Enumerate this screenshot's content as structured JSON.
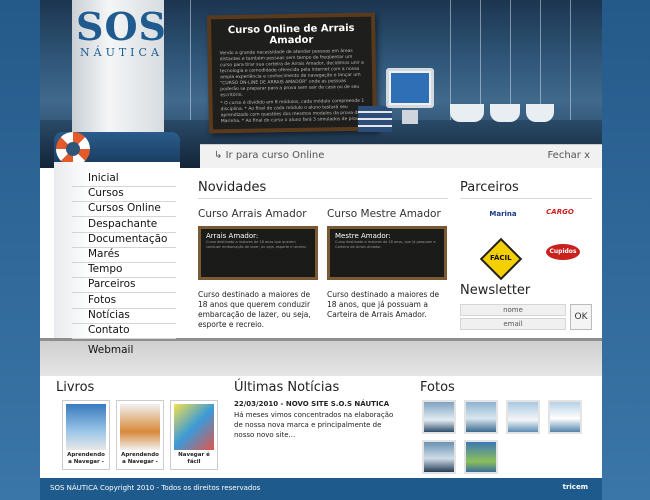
{
  "logo": {
    "sos": "SOS",
    "nautica": "NÁUTICA"
  },
  "banner": {
    "board_title": "Curso Online de Arrais Amador",
    "board_text": "Vendo a grande necessidade de atender pessoas em áreas distantes e também pessoas sem tempo de freqüentar um curso para tirar sua carteira de Arrais Amador, decidimos unir a tecnologia e comodidade oferecida pela internet com a nossa ampla experiência e conhecimento de navegação e lançar um \"CURSO ON-LINE DE ARRAIS AMADOR\" onde as pessoas poderão se preparar para a prova sem sair de casa ou de seu escritório.",
    "board_bullets": "* O curso é dividido em 8 módulos, cada módulo compreende 1 disciplina. * Ao final de cada módulo o aluno testará seu aprendizado com questões dos mesmos modelos da prova da Marinha. * Ao final do curso o aluno fará 3 simulados de prova.",
    "curso_link": "Ir para curso Online",
    "fechar": "Fechar x"
  },
  "nav": [
    "Inicial",
    "Cursos",
    "Cursos Online",
    "Despachante",
    "Documentação",
    "Marés",
    "Tempo",
    "Parceiros",
    "Fotos",
    "Notícias",
    "Contato",
    "Webmail"
  ],
  "novidades": {
    "heading": "Novidades",
    "items": [
      {
        "title": "Curso Arrais Amador",
        "board_title": "Arrais Amador:",
        "board_text": "Curso destinado a maiores de 18 anos que querem conduzir embarcação de lazer, ou seja, esporte e recreio.",
        "desc": "Curso destinado a maiores de 18 anos que querem conduzir embarcação de lazer, ou seja, esporte e recreio."
      },
      {
        "title": "Curso Mestre Amador",
        "board_title": "Mestre Amador:",
        "board_text": "Curso destinado a maiores de 18 anos, que já possuam a Carteira de Arrais Amador.",
        "desc": "Curso destinado a maiores de 18 anos, que já possuam a Carteira de Arrais Amador."
      }
    ]
  },
  "parceiros": {
    "heading": "Parceiros",
    "logos": [
      "Marina",
      "CARGO",
      "FÁCIL",
      "Cupidos"
    ]
  },
  "newsletter": {
    "heading": "Newsletter",
    "nome": "nome",
    "email": "email",
    "ok": "OK"
  },
  "livros": {
    "heading": "Livros",
    "items": [
      "Aprendendo a Navegar -",
      "Aprendendo a Navegar -",
      "Navegar é fácil"
    ]
  },
  "noticias": {
    "heading": "Últimas Notícias",
    "date_title": "22/03/2010 - NOVO SITE S.O.S NÁUTICA",
    "body": "Há meses vimos concentrados na elaboração de nossa nova marca e principalmente de nosso novo site..."
  },
  "fotos": {
    "heading": "Fotos"
  },
  "footer": {
    "copyright": "SOS NÁUTICA Copyright 2010 - Todos os direitos reservados",
    "credit": "tricem"
  },
  "colors": {
    "brand_blue": "#1f5a8c",
    "accent_orange": "#e55a2a"
  }
}
